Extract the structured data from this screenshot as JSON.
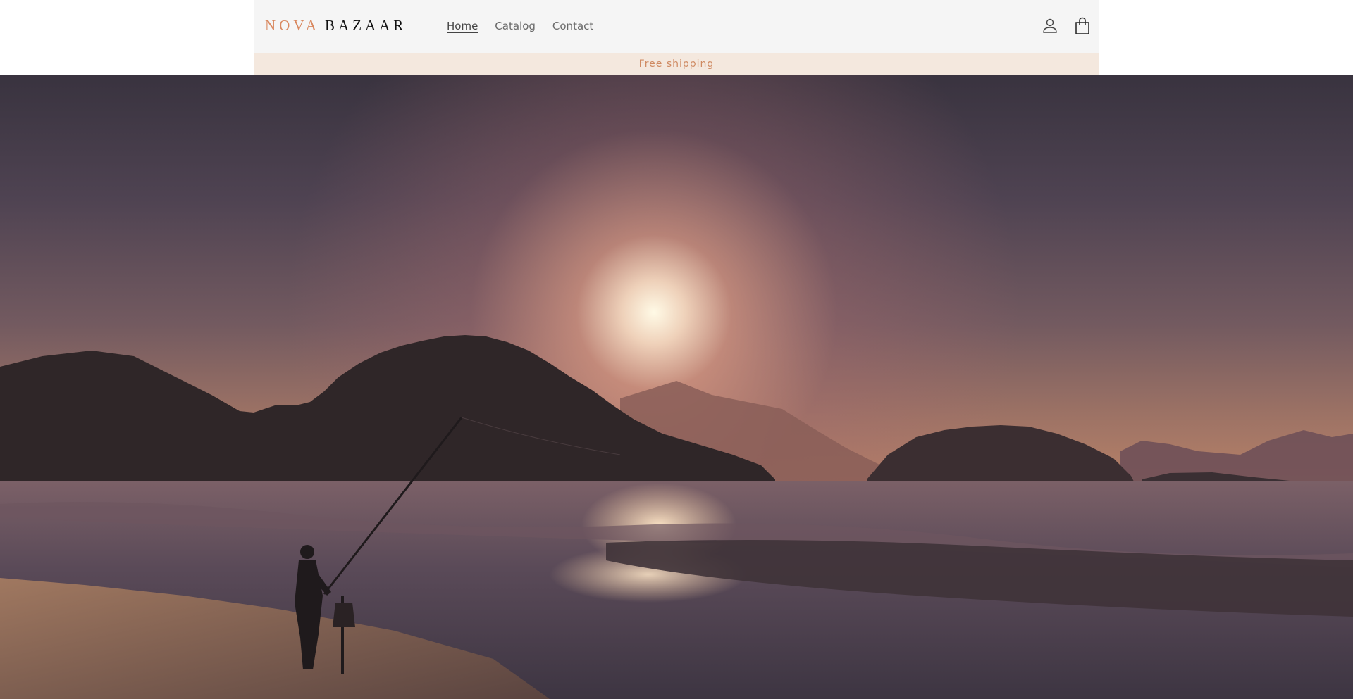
{
  "header": {
    "logo": {
      "part1": "NOVA",
      "part2": "BAZAAR",
      "accent_color": "#d9885f"
    },
    "nav": [
      {
        "label": "Home",
        "active": true
      },
      {
        "label": "Catalog",
        "active": false
      },
      {
        "label": "Contact",
        "active": false
      }
    ],
    "icons": [
      "account-icon",
      "shopping-bag-icon"
    ]
  },
  "announcement": {
    "text": "Free shipping",
    "color": "#cf8a62",
    "background": "#f4e8de"
  },
  "hero": {
    "scene": "beach-sunset-fisherman"
  }
}
